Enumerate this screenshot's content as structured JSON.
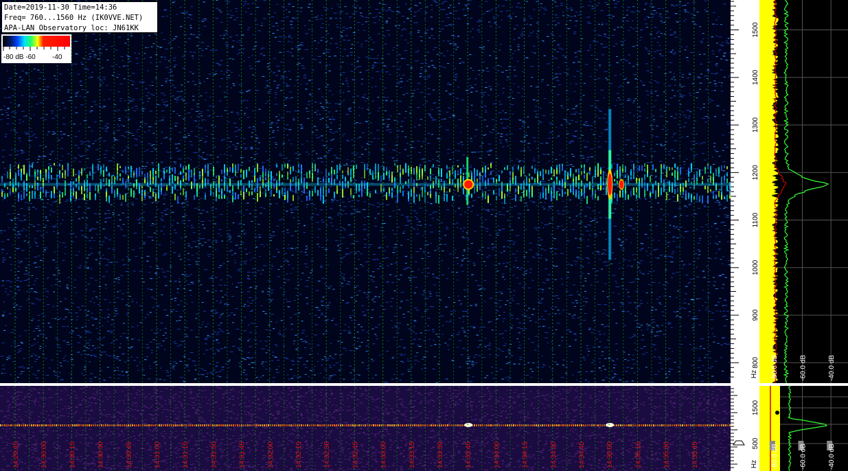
{
  "header": {
    "line1": "Date=2019-11-30 Time=14:36",
    "line2": "Freq= 760...1560 Hz (IK0VVE.NET)",
    "line3": "APA-LAN Observatory loc: JN61KK"
  },
  "colorbar": {
    "label_left": "-80 dB -60",
    "label_right": "-40",
    "colors": [
      "#000000",
      "#001a66",
      "#0044ff",
      "#00e0ff",
      "#22ff66",
      "#ffff00",
      "#ff2200"
    ]
  },
  "chart_data": [
    {
      "type": "heatmap",
      "title": "",
      "ylabel": "Hz",
      "ylim": [
        760,
        1560
      ],
      "y_ticks": [
        "800",
        "900",
        "1000",
        "1100",
        "1200",
        "1300",
        "1400",
        "1500"
      ],
      "y_unit_label": "Hz",
      "signal_band_hz": [
        1150,
        1220
      ],
      "strong_events": [
        {
          "time": "14:33:45",
          "freq_hz": 1175,
          "level_db": -40
        },
        {
          "time": "14:35:00",
          "freq_hz": 1175,
          "level_db": -40
        }
      ],
      "grid": true,
      "colors": {
        "background": "#000000",
        "grid": "#00aa00",
        "noise": "#1f4fd0"
      }
    },
    {
      "type": "line",
      "title": "",
      "orientation": "vertical spectrum",
      "xlabel": "dB",
      "x_ticks": [
        "-80.0 dB",
        "-60.0 dB",
        "-40.0 dB"
      ],
      "peak": {
        "freq_hz": 1175,
        "level_db": -40
      },
      "series": [],
      "colors": {
        "green": "#33ff33",
        "yellow": "#ffff00",
        "red": "#ff0000"
      }
    },
    {
      "type": "heatmap",
      "title": "",
      "x_ticks": [
        "14:29:45",
        "14:30:00",
        "14:30:15",
        "14:30:30",
        "14:30:45",
        "14:31:00",
        "14:31:15",
        "14:31:30",
        "14:31:45",
        "14:32:00",
        "14:32:15",
        "14:32:30",
        "14:32:45",
        "14:33:00",
        "14:33:15",
        "14:33:30",
        "14:33:45",
        "14:34:00",
        "14:34:15",
        "14:34:30",
        "14:34:45",
        "14:35:00",
        "14:35:15",
        "14:35:30",
        "14:35:45"
      ],
      "y_ticks": [
        "1500",
        "500"
      ],
      "y_unit_label": "Hz",
      "grid": true
    },
    {
      "type": "line",
      "title": "",
      "xlabel": "dB",
      "x_ticks": [
        "-80.0 dB",
        "-60.0 dB",
        "-40.0 dB"
      ],
      "series": []
    }
  ]
}
